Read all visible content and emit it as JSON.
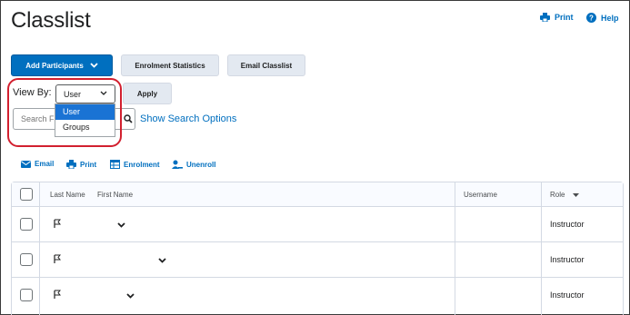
{
  "page": {
    "title": "Classlist"
  },
  "header_links": {
    "print": "Print",
    "help": "Help"
  },
  "toolbar": {
    "add_participants": "Add Participants",
    "enrolment_statistics": "Enrolment Statistics",
    "email_classlist": "Email Classlist"
  },
  "view_by": {
    "label": "View By:",
    "selected": "User",
    "apply": "Apply",
    "options": [
      "User",
      "Groups"
    ]
  },
  "search": {
    "placeholder": "Search F",
    "show_options": "Show Search Options"
  },
  "actions": {
    "email": "Email",
    "print": "Print",
    "enrolment": "Enrolment",
    "unenroll": "Unenroll"
  },
  "table": {
    "headers": {
      "last_name": "Last Name",
      "first_name": "First Name",
      "username": "Username",
      "role": "Role"
    },
    "rows": [
      {
        "role": "Instructor"
      },
      {
        "role": "Instructor"
      },
      {
        "role": "Instructor"
      }
    ]
  },
  "colors": {
    "accent": "#006fbf",
    "highlight": "#d2202f"
  }
}
